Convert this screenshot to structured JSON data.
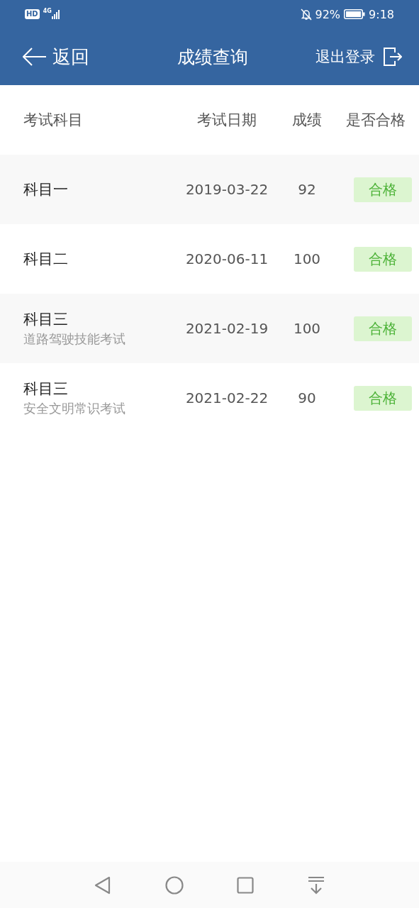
{
  "status_bar": {
    "network_badge": "HD",
    "network_type": "4G",
    "battery_percent": "92%",
    "time": "9:18"
  },
  "header": {
    "back_label": "返回",
    "title": "成绩查询",
    "logout_label": "退出登录"
  },
  "table": {
    "columns": [
      "考试科目",
      "考试日期",
      "成绩",
      "是否合格"
    ],
    "rows": [
      {
        "subject": "科目一",
        "date": "2019-03-22",
        "score": "92",
        "result": "合格",
        "passed": true
      },
      {
        "subject": "科目二",
        "date": "2020-06-11",
        "score": "100",
        "result": "合格",
        "passed": true
      },
      {
        "subject": "科目三",
        "subtitle": "道路驾驶技能考试",
        "date": "2021-02-19",
        "score": "100",
        "result": "合格",
        "passed": true
      },
      {
        "subject": "科目三",
        "subtitle": "安全文明常识考试",
        "date": "2021-02-22",
        "score": "90",
        "result": "合格",
        "passed": true
      }
    ]
  }
}
